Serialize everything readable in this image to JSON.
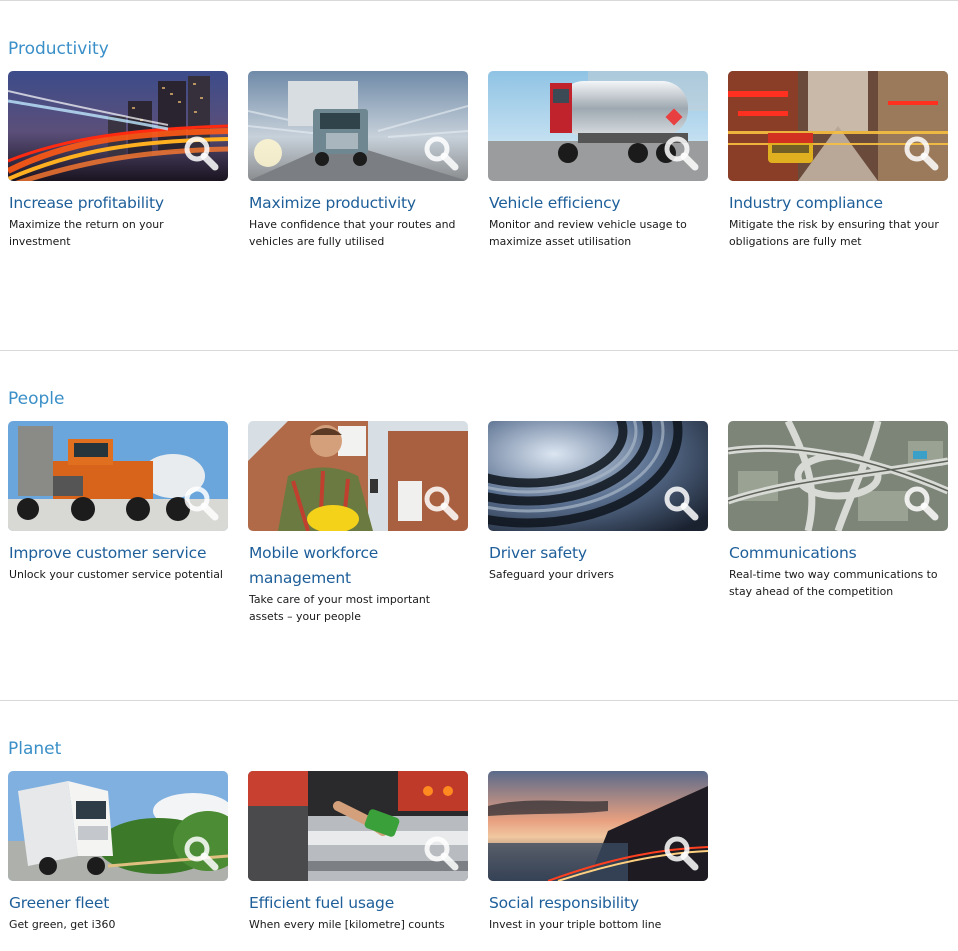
{
  "sections": [
    {
      "title": "Productivity",
      "cards": [
        {
          "title": "Increase profitability",
          "desc": "Maximize the return on your investment"
        },
        {
          "title": "Maximize productivity",
          "desc": "Have confidence that your routes and vehicles are fully utilised"
        },
        {
          "title": "Vehicle efficiency",
          "desc": "Monitor and review vehicle usage to maximize asset utilisation"
        },
        {
          "title": "Industry compliance",
          "desc": "Mitigate the risk by ensuring that your obligations are fully met"
        }
      ]
    },
    {
      "title": "People",
      "cards": [
        {
          "title": "Improve customer service",
          "desc": "Unlock your customer service potential"
        },
        {
          "title": "Mobile workforce management",
          "desc": "Take care of your most important assets – your people"
        },
        {
          "title": "Driver safety",
          "desc": "Safeguard your drivers"
        },
        {
          "title": "Communications",
          "desc": "Real-time two way communications to stay ahead of the competition"
        }
      ]
    },
    {
      "title": "Planet",
      "cards": [
        {
          "title": "Greener fleet",
          "desc": "Get green, get i360"
        },
        {
          "title": "Efficient fuel usage",
          "desc": "When every mile [kilometre] counts"
        },
        {
          "title": "Social responsibility",
          "desc": "Invest in your triple bottom line"
        }
      ]
    }
  ],
  "colors": {
    "section_title": "#3a8fc8",
    "card_title": "#1e5f9a",
    "divider": "#d9d9d9"
  },
  "icons": {
    "magnifier": "search-icon"
  }
}
